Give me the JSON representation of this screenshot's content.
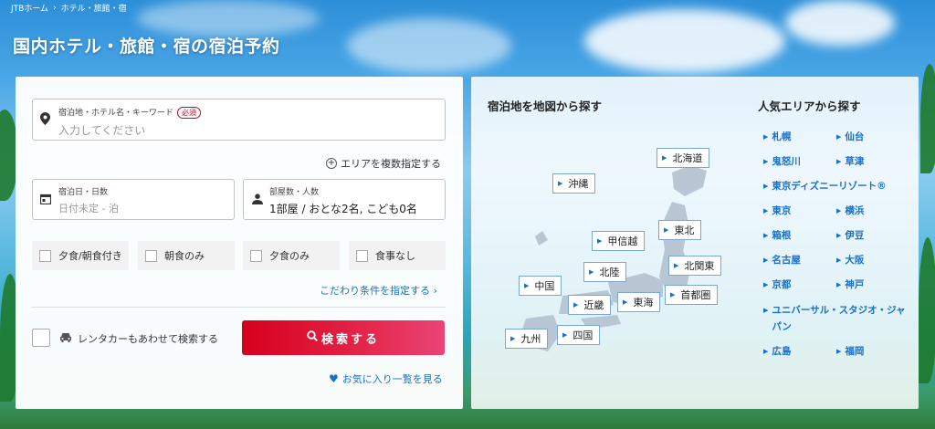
{
  "breadcrumb": [
    "JTBホーム",
    "ホテル・旅館・宿"
  ],
  "page_title": "国内ホテル・旅館・宿の宿泊予約",
  "destination": {
    "label": "宿泊地・ホテル名・キーワード",
    "required": "必須",
    "placeholder": "入力してください"
  },
  "multi_area": "エリアを複数指定する",
  "date": {
    "label": "宿泊日・日数",
    "value": "日付未定 - 泊"
  },
  "rooms": {
    "label": "部屋数・人数",
    "value": "1部屋 / おとな2名, こども0名"
  },
  "meals": [
    "夕食/朝食付き",
    "朝食のみ",
    "夕食のみ",
    "食事なし"
  ],
  "conditions_link": "こだわり条件を指定する ›",
  "rental_car": "レンタカーもあわせて検索する",
  "search_button": "検索する",
  "favorites": "お気に入り一覧を見る",
  "map_title": "宿泊地を地図から探す",
  "map_regions": [
    "北海道",
    "沖縄",
    "東北",
    "甲信越",
    "北陸",
    "北関東",
    "中国",
    "首都圏",
    "近畿",
    "東海",
    "四国",
    "九州"
  ],
  "popular_title": "人気エリアから探す",
  "popular_areas": [
    [
      "札幌",
      "仙台"
    ],
    [
      "鬼怒川",
      "草津"
    ],
    [
      "東京ディズニーリゾート®"
    ],
    [
      "東京",
      "横浜"
    ],
    [
      "箱根",
      "伊豆"
    ],
    [
      "名古屋",
      "大阪"
    ],
    [
      "京都",
      "神戸"
    ],
    [
      "ユニバーサル・スタジオ・ジャパン"
    ],
    [
      "広島",
      "福岡"
    ]
  ],
  "colors": {
    "accent": "#1a6fc9",
    "search": "#d6001c",
    "required": "#d0021b"
  }
}
